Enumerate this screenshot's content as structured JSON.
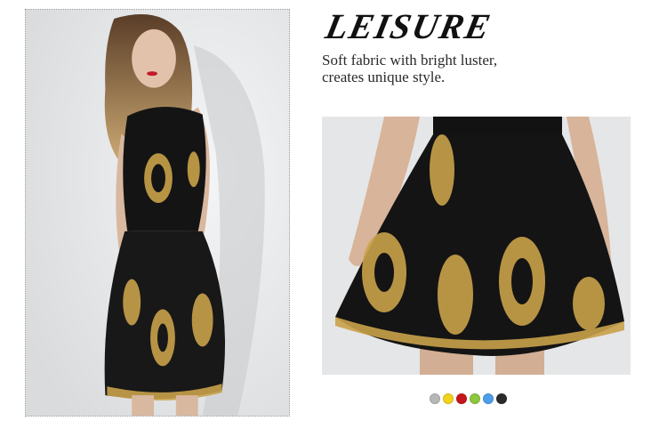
{
  "product": {
    "headline": "LEISURE",
    "tagline_line1": "Soft fabric with bright luster,",
    "tagline_line2": "creates unique style."
  },
  "images": {
    "main": "model-in-black-gold-sequin-dress",
    "detail": "close-up-dress-skirt"
  },
  "swatches": [
    {
      "name": "silver",
      "color": "#b7b7b7"
    },
    {
      "name": "yellow",
      "color": "#f2d21b"
    },
    {
      "name": "red",
      "color": "#c4161c"
    },
    {
      "name": "green",
      "color": "#8dc63f"
    },
    {
      "name": "blue",
      "color": "#4f9ee8"
    },
    {
      "name": "black",
      "color": "#2b2b2b"
    }
  ],
  "colors": {
    "dress": "#141414",
    "gold": "#c9a24a",
    "skin": "#d9b8a0"
  }
}
